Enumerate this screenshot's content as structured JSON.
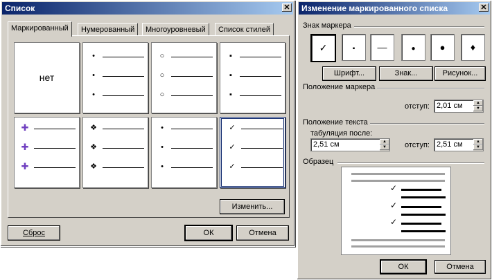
{
  "left_dialog": {
    "title": "Список",
    "tabs": [
      {
        "label": "Маркированный"
      },
      {
        "label": "Нумерованный"
      },
      {
        "label": "Многоуровневый"
      },
      {
        "label": "Список стилей"
      }
    ],
    "none_label": "нет",
    "bullet_glyphs": [
      "•",
      "○",
      "▪",
      "✚",
      "❖",
      "•",
      "✓"
    ],
    "modify_button": "Изменить...",
    "reset_button": "Сброс",
    "ok_button": "ОК",
    "cancel_button": "Отмена"
  },
  "right_dialog": {
    "title": "Изменение маркированного списка",
    "marker_group": "Знак маркера",
    "marker_glyphs": [
      "✓",
      "▪",
      "—",
      "●",
      "●",
      "♦"
    ],
    "font_button": "Шрифт...",
    "char_button": "Знак...",
    "picture_button": "Рисунок...",
    "marker_pos_group": "Положение маркера",
    "indent_label": "отступ:",
    "marker_indent": "2,01 см",
    "text_pos_group": "Положение текста",
    "tab_after_label": "табуляция после:",
    "tab_after_value": "2,51 см",
    "text_indent_label": "отступ:",
    "text_indent_value": "2,51 см",
    "sample_group": "Образец",
    "ok_button": "ОК",
    "cancel_button": "Отмена"
  }
}
